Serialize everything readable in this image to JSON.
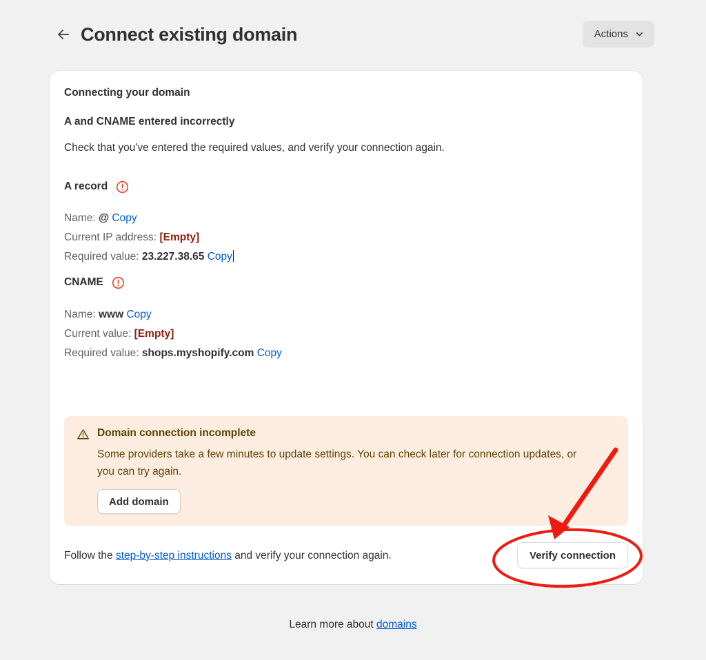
{
  "header": {
    "back_icon": "arrow-left-icon",
    "title": "Connect existing domain",
    "actions_label": "Actions",
    "actions_chevron_icon": "chevron-down-icon"
  },
  "card": {
    "section_title": "Connecting your domain",
    "sub_title": "A and CNAME entered incorrectly",
    "body_text": "Check that you've entered the required values, and verify your connection again.",
    "records": [
      {
        "label": "A record",
        "status_icon": "error-circle-icon",
        "lines": [
          {
            "label": "Name:",
            "value": "@",
            "value_style": "strong",
            "copy_label": "Copy",
            "has_caret": false
          },
          {
            "label": "Current IP address:",
            "value": "[Empty]",
            "value_style": "empty",
            "copy_label": "",
            "has_caret": false
          },
          {
            "label": "Required value:",
            "value": "23.227.38.65",
            "value_style": "strong",
            "copy_label": "Copy",
            "has_caret": true
          }
        ]
      },
      {
        "label": "CNAME",
        "status_icon": "error-circle-icon",
        "lines": [
          {
            "label": "Name:",
            "value": "www",
            "value_style": "strong",
            "copy_label": "Copy",
            "has_caret": false
          },
          {
            "label": "Current value:",
            "value": "[Empty]",
            "value_style": "empty",
            "copy_label": "",
            "has_caret": false
          },
          {
            "label": "Required value:",
            "value": "shops.myshopify.com",
            "value_style": "strong",
            "copy_label": "Copy",
            "has_caret": false
          }
        ]
      }
    ],
    "warning": {
      "icon": "warning-triangle-icon",
      "title": "Domain connection incomplete",
      "text": "Some providers take a few minutes to update settings. You can check later for connection updates, or you can try again.",
      "button_label": "Add domain"
    },
    "footer": {
      "text_before": "Follow the ",
      "link_label": "step-by-step instructions",
      "text_after": " and verify your connection again.",
      "verify_label": "Verify connection"
    }
  },
  "page_footer": {
    "text_before": "Learn more about ",
    "link_label": "domains"
  },
  "colors": {
    "page_background": "#F1F1F1",
    "card_background": "#FFFFFF",
    "accent_link": "#005BD3",
    "error_icon": "#F4431C",
    "error_text": "#8E1F0B",
    "warning_background": "#FDEDE0",
    "warning_text": "#5E4200",
    "annotation_red": "#EE1B11",
    "text_primary": "#303030",
    "text_secondary": "#616161",
    "actions_button_background": "#E3E3E3"
  },
  "annotations": {
    "arrow": "red-arrow-pointing-to-verify-connection",
    "ellipse": "red-ellipse-highlighting-verify-connection"
  }
}
